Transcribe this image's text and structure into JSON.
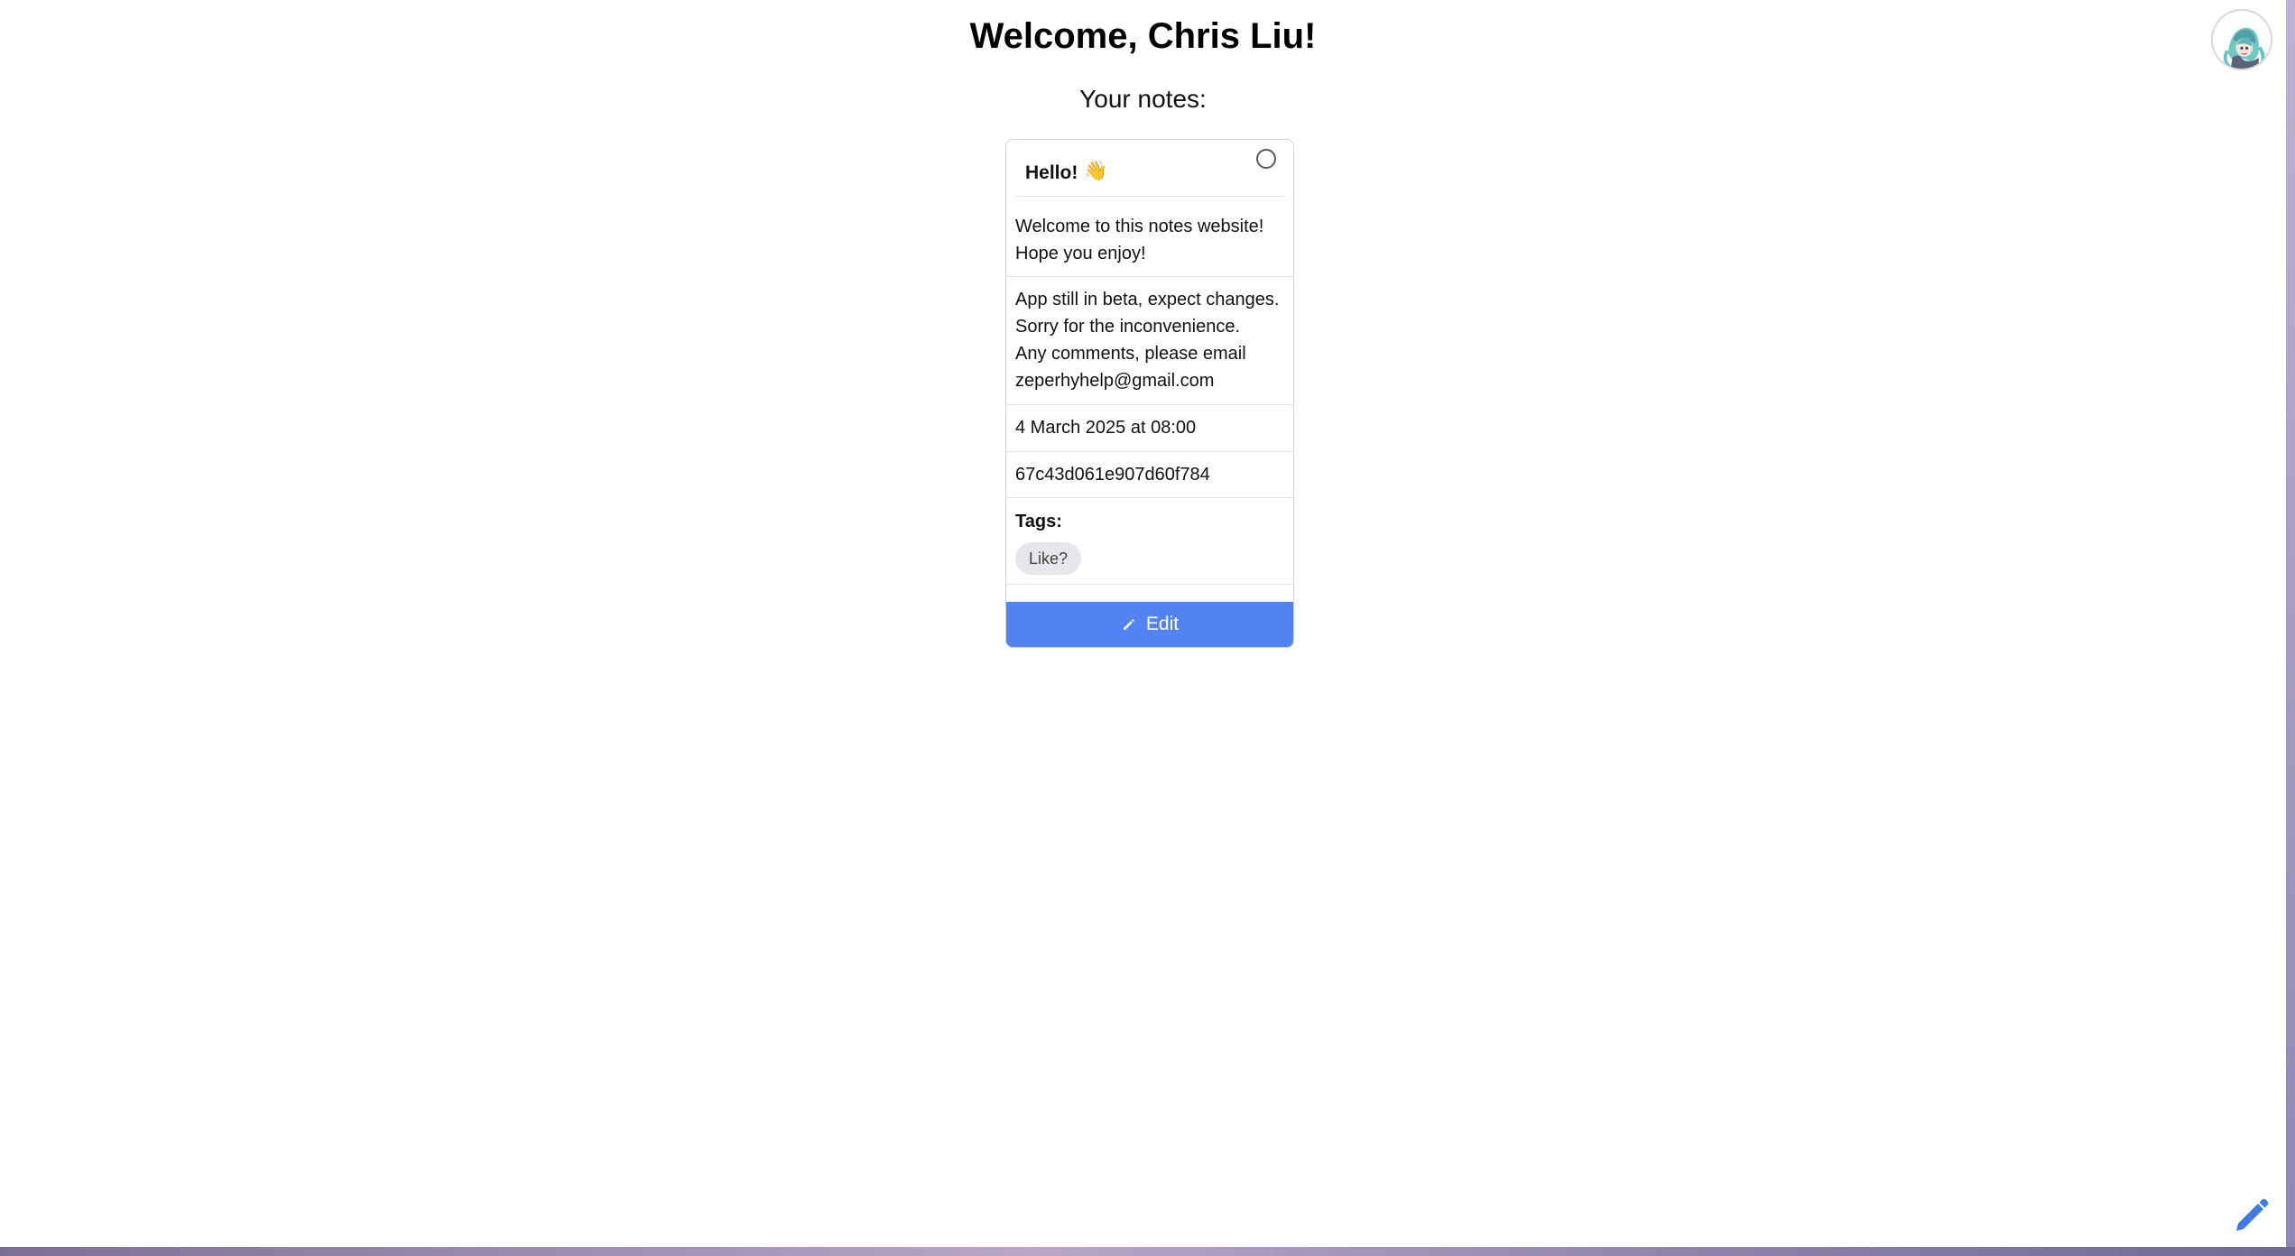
{
  "header": {
    "title": "Welcome, Chris Liu!",
    "subtitle": "Your notes:"
  },
  "note": {
    "title": "Hello!",
    "emoji": "👋",
    "message_lines": [
      "Welcome to this notes website!",
      "Hope you enjoy!"
    ],
    "notice_lines": [
      "App still in beta, expect changes.",
      "Sorry for the inconvenience.",
      "Any comments, please email",
      "zeperhyhelp@gmail.com"
    ],
    "date": "4 March 2025 at 08:00",
    "id": "67c43d061e907d60f784",
    "tags_label": "Tags:",
    "tags": [
      "Like?"
    ],
    "edit_label": "Edit"
  },
  "icons": {
    "avatar": "avatar-icon",
    "select": "circle-select-icon",
    "edit": "pencil-icon",
    "new_note": "pencil-icon"
  },
  "colors": {
    "accent": "#5383f3",
    "tag_bg": "#e5e7eb",
    "card_border": "#d5d5d5"
  }
}
